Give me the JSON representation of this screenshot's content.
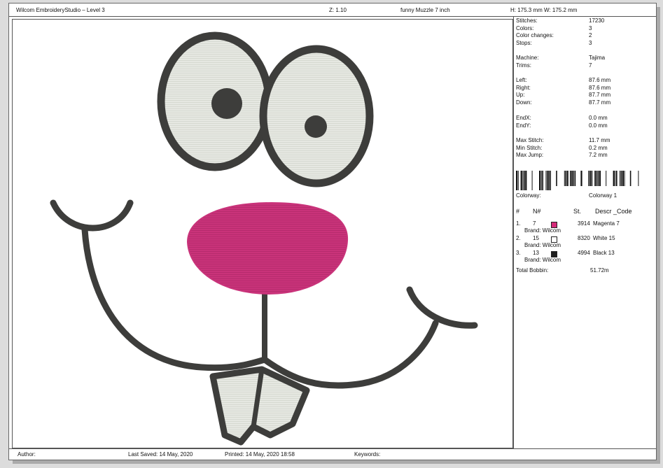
{
  "header": {
    "app_title": "Wilcom EmbroideryStudio – Level 3",
    "zoom": "Z: 1.10",
    "design_name": "funny Muzzle 7 inch",
    "size": "H: 175.3 mm   W: 175.2 mm"
  },
  "stats": [
    {
      "label": "Stitches:",
      "value": "17230"
    },
    {
      "label": "Colors:",
      "value": "3"
    },
    {
      "label": "Color changes:",
      "value": "2"
    },
    {
      "label": "Stops:",
      "value": "3"
    },
    {
      "label": "Machine:",
      "value": "Tajima"
    },
    {
      "label": "Trims:",
      "value": "7"
    },
    {
      "label": "Left:",
      "value": "87.6 mm"
    },
    {
      "label": "Right:",
      "value": "87.6 mm"
    },
    {
      "label": "Up:",
      "value": "87.7 mm"
    },
    {
      "label": "Down:",
      "value": "87.7 mm"
    },
    {
      "label": "EndX:",
      "value": "0.0 mm"
    },
    {
      "label": "EndY:",
      "value": "0.0 mm"
    },
    {
      "label": "Max Stitch:",
      "value": "11.7 mm"
    },
    {
      "label": "Min Stitch:",
      "value": "0.2 mm"
    },
    {
      "label": "Max Jump:",
      "value": "7.2 mm"
    }
  ],
  "colorway": {
    "label": "Colorway:",
    "value": "Colorway 1"
  },
  "table": {
    "headers": {
      "num": "#",
      "n": "N#",
      "st": "St.",
      "desc": "Descr _Code"
    },
    "rows": [
      {
        "idx": "1.",
        "n": "7",
        "swatch": "#d42a78",
        "st": "3914",
        "desc": "Magenta 7",
        "brand": "Brand: Wilcom"
      },
      {
        "idx": "2.",
        "n": "15",
        "swatch": "#ffffff",
        "st": "8320",
        "desc": "White 15",
        "brand": "Brand: Wilcom"
      },
      {
        "idx": "3.",
        "n": "13",
        "swatch": "#1e1e1e",
        "st": "4994",
        "desc": "Black 13",
        "brand": "Brand: Wilcom"
      }
    ],
    "total_label": "Total Bobbin:",
    "total_value": "51.72m"
  },
  "footer": {
    "author": "Author:",
    "last_saved": "Last Saved: 14 May, 2020",
    "printed": "Printed: 14 May, 2020 18:58",
    "keywords": "Keywords:"
  },
  "design_colors": {
    "outline": "#3d3d3b",
    "fill": "#e6e8e2",
    "nose": "#c9337a"
  }
}
